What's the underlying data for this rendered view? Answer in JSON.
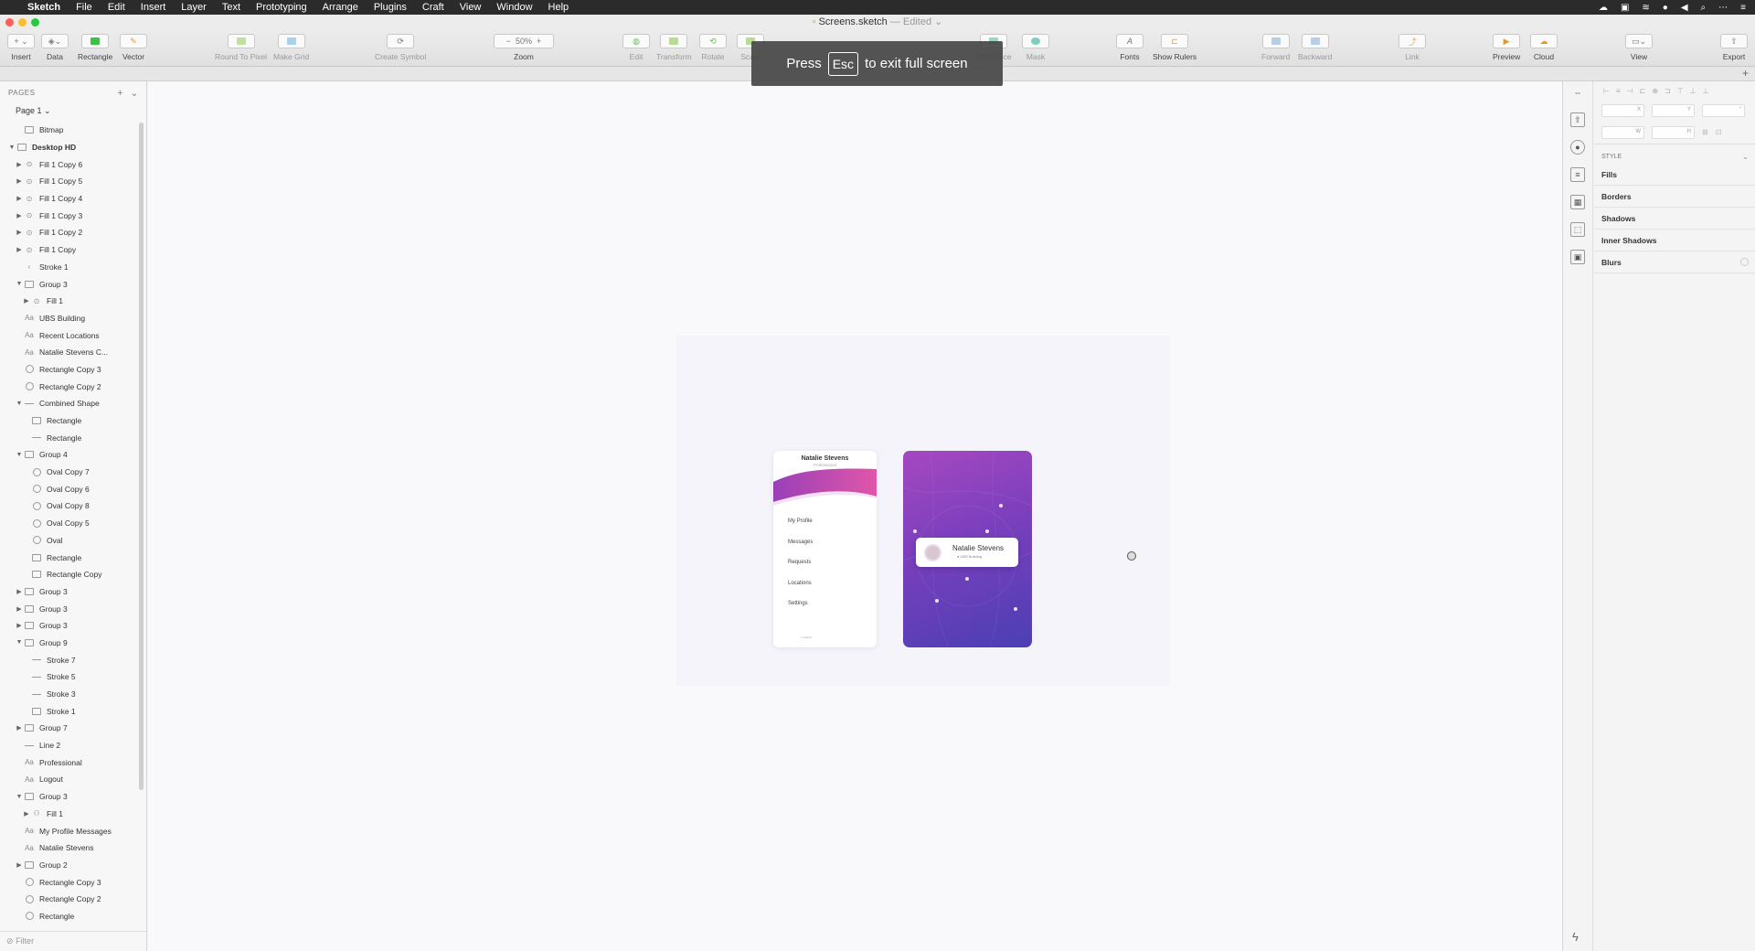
{
  "menubar": {
    "app": "Sketch",
    "items": [
      "File",
      "Edit",
      "Insert",
      "Layer",
      "Text",
      "Prototyping",
      "Arrange",
      "Plugins",
      "Craft",
      "View",
      "Window",
      "Help"
    ]
  },
  "window": {
    "title": "Screens.sketch",
    "status": "— Edited"
  },
  "toolbar": {
    "insert": "Insert",
    "data": "Data",
    "rectangle": "Rectangle",
    "vector": "Vector",
    "round_to_pixel": "Round To Pixel",
    "make_grid": "Make Grid",
    "create_symbol": "Create Symbol",
    "zoom_value": "50%",
    "zoom": "Zoom",
    "edit": "Edit",
    "transform": "Transform",
    "rotate": "Rotate",
    "scale": "Scale",
    "difference": "Difference",
    "mask": "Mask",
    "fonts": "Fonts",
    "show_rulers": "Show Rulers",
    "forward": "Forward",
    "backward": "Backward",
    "link": "Link",
    "preview": "Preview",
    "cloud": "Cloud",
    "view": "View",
    "export": "Export"
  },
  "toast": {
    "before": "Press",
    "key": "Esc",
    "after": "to exit full screen"
  },
  "layers": {
    "pages_label": "PAGES",
    "page": "Page 1",
    "items": [
      {
        "label": "Bitmap",
        "indent": 1,
        "icon": "image",
        "tri": ""
      },
      {
        "label": "Desktop HD",
        "indent": 0,
        "icon": "artboard",
        "tri": "▼",
        "bold": true
      },
      {
        "label": "Fill 1 Copy 6",
        "indent": 1,
        "icon": "pin",
        "tri": "▶"
      },
      {
        "label": "Fill 1 Copy 5",
        "indent": 1,
        "icon": "pin",
        "tri": "▶"
      },
      {
        "label": "Fill 1 Copy 4",
        "indent": 1,
        "icon": "pin",
        "tri": "▶"
      },
      {
        "label": "Fill 1 Copy 3",
        "indent": 1,
        "icon": "pin",
        "tri": "▶"
      },
      {
        "label": "Fill 1 Copy 2",
        "indent": 1,
        "icon": "pin",
        "tri": "▶"
      },
      {
        "label": "Fill 1 Copy",
        "indent": 1,
        "icon": "pin",
        "tri": "▶"
      },
      {
        "label": "Stroke 1",
        "indent": 1,
        "icon": "stroke",
        "tri": ""
      },
      {
        "label": "Group 3",
        "indent": 1,
        "icon": "folder",
        "tri": "▼"
      },
      {
        "label": "Fill 1",
        "indent": 2,
        "icon": "pin",
        "tri": "▶"
      },
      {
        "label": "UBS Building",
        "indent": 1,
        "icon": "text",
        "tri": ""
      },
      {
        "label": "Recent Locations",
        "indent": 1,
        "icon": "text",
        "tri": ""
      },
      {
        "label": "Natalie Stevens C...",
        "indent": 1,
        "icon": "text",
        "tri": ""
      },
      {
        "label": "Rectangle Copy 3",
        "indent": 1,
        "icon": "oval",
        "tri": ""
      },
      {
        "label": "Rectangle Copy 2",
        "indent": 1,
        "icon": "oval",
        "tri": ""
      },
      {
        "label": "Combined Shape",
        "indent": 1,
        "icon": "line",
        "tri": "▼"
      },
      {
        "label": "Rectangle",
        "indent": 2,
        "icon": "rect",
        "tri": ""
      },
      {
        "label": "Rectangle",
        "indent": 2,
        "icon": "line",
        "tri": ""
      },
      {
        "label": "Group 4",
        "indent": 1,
        "icon": "folder",
        "tri": "▼"
      },
      {
        "label": "Oval Copy 7",
        "indent": 2,
        "icon": "oval",
        "tri": ""
      },
      {
        "label": "Oval Copy 6",
        "indent": 2,
        "icon": "oval",
        "tri": ""
      },
      {
        "label": "Oval Copy 8",
        "indent": 2,
        "icon": "oval",
        "tri": ""
      },
      {
        "label": "Oval Copy 5",
        "indent": 2,
        "icon": "oval",
        "tri": ""
      },
      {
        "label": "Oval",
        "indent": 2,
        "icon": "oval",
        "tri": ""
      },
      {
        "label": "Rectangle",
        "indent": 2,
        "icon": "rect",
        "tri": ""
      },
      {
        "label": "Rectangle Copy",
        "indent": 2,
        "icon": "rect",
        "tri": ""
      },
      {
        "label": "Group 3",
        "indent": 1,
        "icon": "folder",
        "tri": "▶"
      },
      {
        "label": "Group 3",
        "indent": 1,
        "icon": "folder",
        "tri": "▶"
      },
      {
        "label": "Group 3",
        "indent": 1,
        "icon": "folder",
        "tri": "▶"
      },
      {
        "label": "Group 9",
        "indent": 1,
        "icon": "folder",
        "tri": "▼"
      },
      {
        "label": "Stroke 7",
        "indent": 2,
        "icon": "line",
        "tri": ""
      },
      {
        "label": "Stroke 5",
        "indent": 2,
        "icon": "line",
        "tri": ""
      },
      {
        "label": "Stroke 3",
        "indent": 2,
        "icon": "line",
        "tri": ""
      },
      {
        "label": "Stroke 1",
        "indent": 2,
        "icon": "rect",
        "tri": ""
      },
      {
        "label": "Group 7",
        "indent": 1,
        "icon": "folder",
        "tri": "▶"
      },
      {
        "label": "Line 2",
        "indent": 1,
        "icon": "line",
        "tri": ""
      },
      {
        "label": "Professional",
        "indent": 1,
        "icon": "text",
        "tri": ""
      },
      {
        "label": "Logout",
        "indent": 1,
        "icon": "text",
        "tri": ""
      },
      {
        "label": "Group 3",
        "indent": 1,
        "icon": "folder",
        "tri": "▼"
      },
      {
        "label": "Fill 1",
        "indent": 2,
        "icon": "person",
        "tri": "▶"
      },
      {
        "label": "My Profile Messages",
        "indent": 1,
        "icon": "text",
        "tri": ""
      },
      {
        "label": "Natalie Stevens",
        "indent": 1,
        "icon": "text",
        "tri": ""
      },
      {
        "label": "Group 2",
        "indent": 1,
        "icon": "folder",
        "tri": "▶"
      },
      {
        "label": "Rectangle Copy 3",
        "indent": 1,
        "icon": "oval",
        "tri": ""
      },
      {
        "label": "Rectangle Copy 2",
        "indent": 1,
        "icon": "oval",
        "tri": ""
      },
      {
        "label": "Rectangle",
        "indent": 1,
        "icon": "oval",
        "tri": ""
      }
    ],
    "filter_placeholder": "Filter"
  },
  "canvas": {
    "screen1": {
      "name": "Natalie Stevens",
      "subtitle": "Professional",
      "menu": [
        "My Profile",
        "Messages",
        "Requests",
        "Locations",
        "Settings"
      ],
      "logout": "Logout"
    },
    "screen2": {
      "card_name": "Natalie Stevens",
      "card_location": "UBS Building"
    }
  },
  "inspector": {
    "x": "X",
    "y": "Y",
    "w": "W",
    "h": "H",
    "style_label": "STYLE",
    "sections": [
      "Fills",
      "Borders",
      "Shadows",
      "Inner Shadows",
      "Blurs"
    ]
  },
  "colors": {
    "gradient_top": "#a548c0",
    "gradient_bottom": "#4b3fb4",
    "accent": "#8e45c0"
  }
}
